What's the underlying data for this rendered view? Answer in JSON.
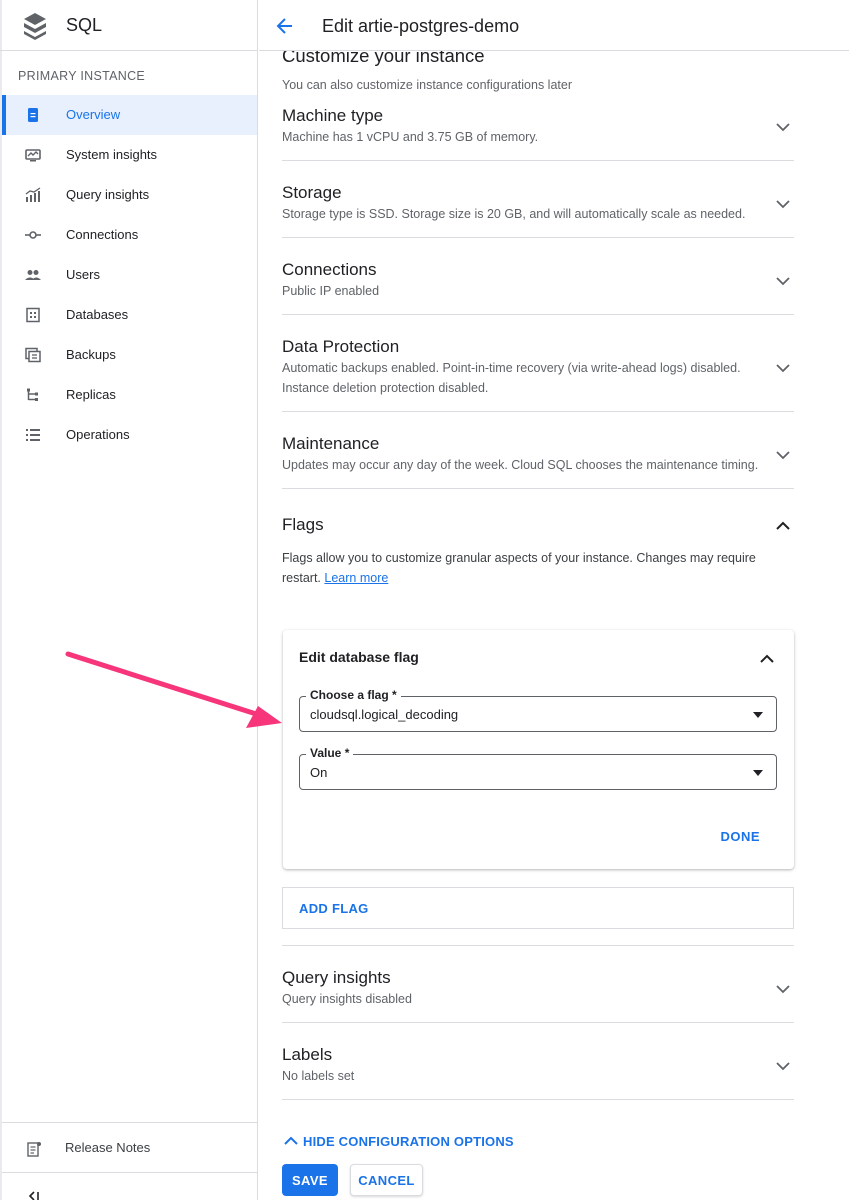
{
  "app": {
    "title": "SQL"
  },
  "sidebar": {
    "section_label": "PRIMARY INSTANCE",
    "items": [
      {
        "label": "Overview",
        "icon": "overview-icon",
        "active": true
      },
      {
        "label": "System insights",
        "icon": "system-insights-icon"
      },
      {
        "label": "Query insights",
        "icon": "query-insights-icon"
      },
      {
        "label": "Connections",
        "icon": "connections-icon"
      },
      {
        "label": "Users",
        "icon": "users-icon"
      },
      {
        "label": "Databases",
        "icon": "databases-icon"
      },
      {
        "label": "Backups",
        "icon": "backups-icon"
      },
      {
        "label": "Replicas",
        "icon": "replicas-icon"
      },
      {
        "label": "Operations",
        "icon": "operations-icon"
      }
    ],
    "release_notes": "Release Notes",
    "collapse_icon": "collapse-sidebar-icon"
  },
  "header": {
    "title": "Edit artie-postgres-demo"
  },
  "customize": {
    "title": "Customize your instance",
    "subtitle": "You can also customize instance configurations later"
  },
  "sections": {
    "machine_type": {
      "title": "Machine type",
      "desc": "Machine has 1 vCPU and 3.75 GB of memory."
    },
    "storage": {
      "title": "Storage",
      "desc": "Storage type is SSD. Storage size is 20 GB, and will automatically scale as needed."
    },
    "connections": {
      "title": "Connections",
      "desc": "Public IP enabled"
    },
    "data_protection": {
      "title": "Data Protection",
      "desc": "Automatic backups enabled. Point-in-time recovery (via write-ahead logs) disabled. Instance deletion protection disabled."
    },
    "maintenance": {
      "title": "Maintenance",
      "desc": "Updates may occur any day of the week. Cloud SQL chooses the maintenance timing."
    },
    "flags": {
      "title": "Flags",
      "desc": "Flags allow you to customize granular aspects of your instance. Changes may require restart.",
      "learn_more": "Learn more"
    },
    "query_insights": {
      "title": "Query insights",
      "desc": "Query insights disabled"
    },
    "labels": {
      "title": "Labels",
      "desc": "No labels set"
    }
  },
  "flag_editor": {
    "title": "Edit database flag",
    "flag_label": "Choose a flag *",
    "flag_value": "cloudsql.logical_decoding",
    "value_label": "Value *",
    "value_value": "On",
    "done": "DONE"
  },
  "add_flag": "ADD FLAG",
  "hide_options": "HIDE CONFIGURATION OPTIONS",
  "actions": {
    "save": "SAVE",
    "cancel": "CANCEL"
  },
  "colors": {
    "accent": "#1a73e8",
    "annotation_arrow": "#f7357a"
  }
}
